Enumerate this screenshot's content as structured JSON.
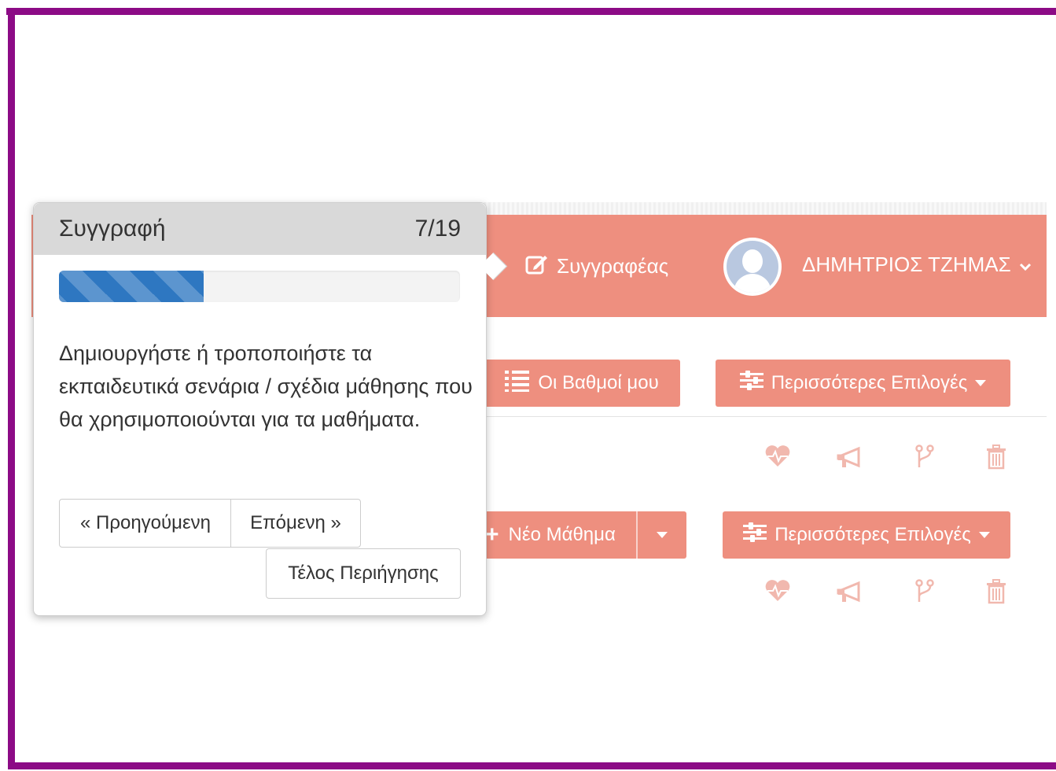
{
  "tour": {
    "title": "Συγγραφή",
    "step_counter": "7/19",
    "progress_fraction": 0.36,
    "description": "Δημιουργήστε ή τροποποιήστε τα εκπαιδευτικά σενάρια / σχέδια μάθησης που θα χρησιμοποιούνται για τα μαθήματα.",
    "prev_label": "« Προηγούμενη",
    "next_label": "Επόμενη »",
    "end_label": "Τέλος Περιήγησης"
  },
  "navbar": {
    "author_label": "Συγγραφέας",
    "user_name": "ΔΗΜΗΤΡΙΟΣ ΤΖΗΜΑΣ"
  },
  "toolbar": {
    "grades_label": "Οι Βαθμοί μου",
    "more_options_label": "Περισσότερες Επιλογές",
    "new_lesson_label": "Νέο Μάθημα",
    "more_options_label_2": "Περισσότερες Επιλογές"
  },
  "colors": {
    "accent": "#ee8f7f",
    "frame": "#8c0b86",
    "progress": "#2e77c1"
  },
  "icons": [
    "edit-icon",
    "avatar-icon",
    "chevron-down-icon",
    "list-icon",
    "sliders-icon",
    "caret-down-icon",
    "plus-icon",
    "heartbeat-icon",
    "megaphone-icon",
    "fork-icon",
    "trash-icon"
  ]
}
